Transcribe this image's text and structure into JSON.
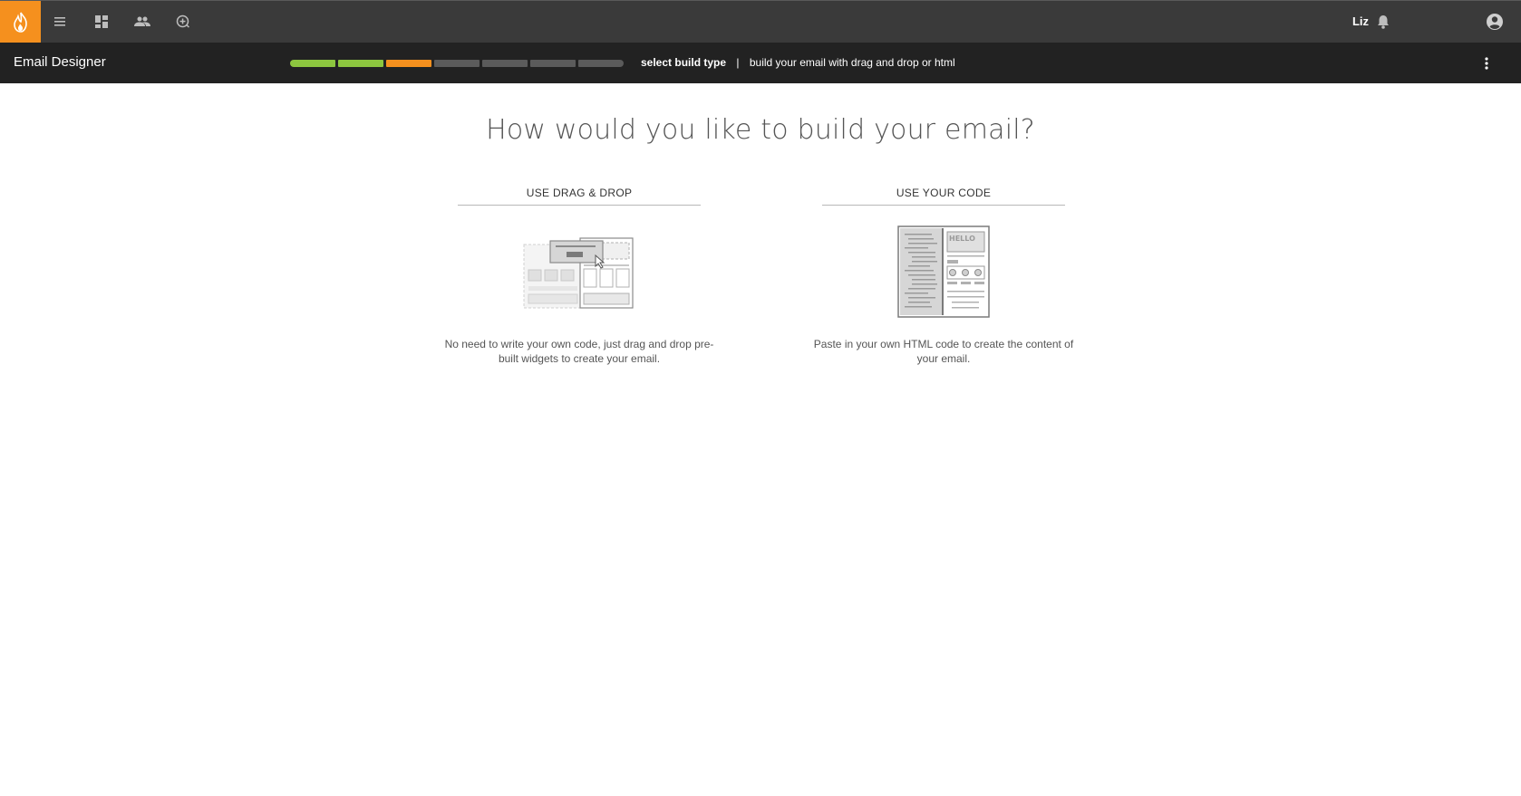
{
  "topbar": {
    "icons": [
      "flame-logo-icon",
      "menu-icon",
      "dashboard-icon",
      "people-icon",
      "add-circle-icon",
      "bell-icon",
      "account-circle-icon"
    ],
    "user_name": "Liz"
  },
  "subbar": {
    "app_title": "Email Designer",
    "progress": {
      "total_steps": 7,
      "completed_steps": 2,
      "current_step": 3,
      "colors": {
        "completed": "#8dc63f",
        "current": "#f5901e",
        "pending": "#5b5b5b"
      }
    },
    "current_step_label": "select build type",
    "separator": "|",
    "step_description": "build your email with drag and drop or html"
  },
  "main": {
    "title": "How would you like to build your email?",
    "options": [
      {
        "heading": "USE DRAG & DROP",
        "description": "No need to write your own code, just drag and drop pre-built widgets to create your email."
      },
      {
        "heading": "USE YOUR CODE",
        "description": "Paste in your own HTML code to create the content of your email."
      }
    ]
  },
  "colors": {
    "accent": "#f5901e",
    "topbar": "#3a3a3a",
    "subbar": "#222222"
  }
}
